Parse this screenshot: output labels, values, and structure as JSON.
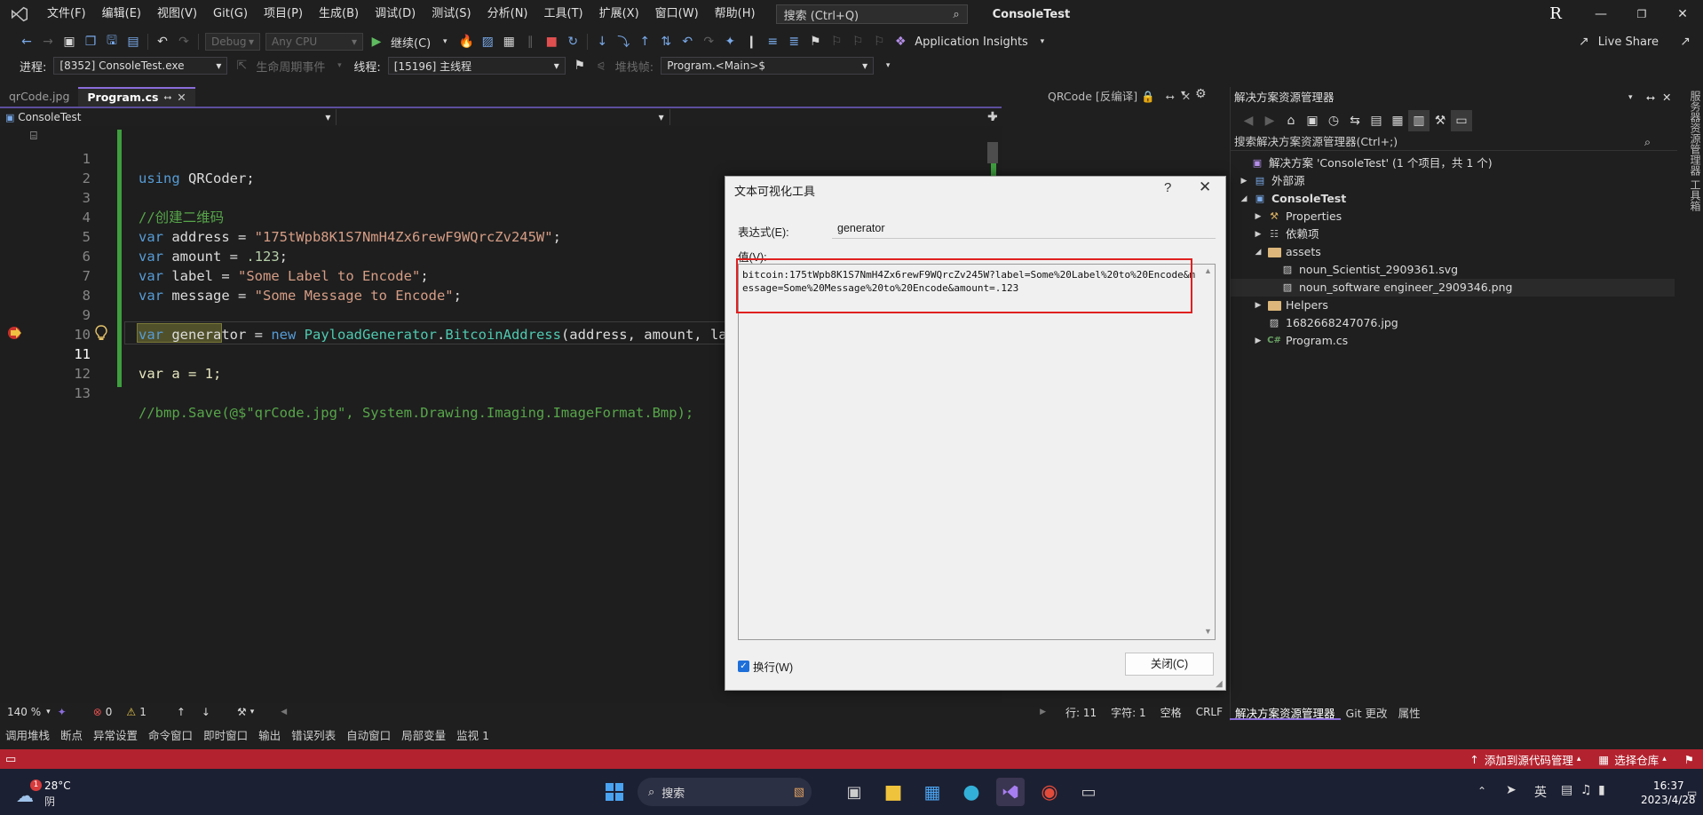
{
  "menubar": {
    "items": [
      "文件(F)",
      "编辑(E)",
      "视图(V)",
      "Git(G)",
      "项目(P)",
      "生成(B)",
      "调试(D)",
      "测试(S)",
      "分析(N)",
      "工具(T)",
      "扩展(X)",
      "窗口(W)",
      "帮助(H)"
    ],
    "search_placeholder": "搜索 (Ctrl+Q)",
    "app_title": "ConsoleTest",
    "user_initial": "R"
  },
  "toolbar1": {
    "config": "Debug",
    "platform": "Any CPU",
    "continue_label": "继续(C)",
    "app_insights": "Application Insights",
    "live_share": "Live Share"
  },
  "toolbar2": {
    "process_label": "进程:",
    "process_value": "[8352] ConsoleTest.exe",
    "lifecycle_label": "生命周期事件",
    "thread_label": "线程:",
    "thread_value": "[15196] 主线程",
    "stack_label": "堆栈帧:",
    "stack_value": "Program.<Main>$"
  },
  "editor_tabs": [
    {
      "label": "qrCode.jpg",
      "active": false
    },
    {
      "label": "Program.cs",
      "active": true
    }
  ],
  "qr_tab": "QRCode [反编译]",
  "navbar": {
    "project": "ConsoleTest"
  },
  "code_lines": [
    {
      "n": "1"
    },
    {
      "n": "2"
    },
    {
      "n": "3"
    },
    {
      "n": "4"
    },
    {
      "n": "5"
    },
    {
      "n": "6"
    },
    {
      "n": "7"
    },
    {
      "n": "8"
    },
    {
      "n": "9"
    },
    {
      "n": "10"
    },
    {
      "n": "11"
    },
    {
      "n": "12"
    },
    {
      "n": "13"
    }
  ],
  "code": {
    "l1_kw": "using",
    "l1_rest": " QRCoder;",
    "l3": "//创建二维码",
    "l4_kw": "var",
    "l4_id": " address = ",
    "l4_str": "\"175tWpb8K1S7NmH4Zx6rewF9WQrcZv245W\"",
    "l4_end": ";",
    "l5_kw": "var",
    "l5_id": " amount = ",
    "l5_num": ".123",
    "l5_end": ";",
    "l6_kw": "var",
    "l6_id": " label = ",
    "l6_str": "\"Some Label to Encode\"",
    "l6_end": ";",
    "l7_kw": "var",
    "l7_id": " message = ",
    "l7_str": "\"Some Message to Encode\"",
    "l7_end": ";",
    "l9_kw": "var",
    "l9_id": " generator = ",
    "l9_new": "new",
    "l9_type": " PayloadGenerator",
    "l9_dot": ".",
    "l9_type2": "BitcoinAddress",
    "l9_args": "(address, amount, labe",
    "l11": "var a = 1;",
    "l13": "//bmp.Save(@$\"qrCode.jpg\", System.Drawing.Imaging.ImageFormat.Bmp);"
  },
  "editor_status": {
    "zoom": "140 %",
    "errors": "0",
    "warnings": "1",
    "line": "行: 11",
    "col": "字符: 1",
    "spaces": "空格",
    "eol": "CRLF"
  },
  "bottom_tabs": [
    "调用堆栈",
    "断点",
    "异常设置",
    "命令窗口",
    "即时窗口",
    "输出",
    "错误列表",
    "自动窗口",
    "局部变量",
    "监视 1"
  ],
  "statusbar": {
    "add_source": "添加到源代码管理",
    "select_repo": "选择仓库"
  },
  "solution": {
    "title": "解决方案资源管理器",
    "search": "搜索解决方案资源管理器(Ctrl+;)",
    "root": "解决方案 'ConsoleTest' (1 个项目，共 1 个)",
    "external": "外部源",
    "project": "ConsoleTest",
    "properties": "Properties",
    "deps": "依赖项",
    "assets": "assets",
    "file_svg": "noun_Scientist_2909361.svg",
    "file_png": "noun_software engineer_2909346.png",
    "helpers": "Helpers",
    "file_jpg": "1682668247076.jpg",
    "program": "Program.cs",
    "tabs": [
      "解决方案资源管理器",
      "Git 更改",
      "属性"
    ],
    "right_strip": "服务器资源管理器 工具箱"
  },
  "dialog": {
    "title": "文本可视化工具",
    "help": "?",
    "expr_label": "表达式(E):",
    "expr_value": "generator",
    "value_label": "值(V):",
    "value_text": "bitcoin:175tWpb8K1S7NmH4Zx6rewF9WQrcZv245W?label=Some%20Label%20to%20Encode&message=Some%20Message%20to%20Encode&amount=.123",
    "wrap_label": "换行(W)",
    "close_label": "关闭(C)"
  },
  "taskbar": {
    "temp": "28°C",
    "weather": "阴",
    "search": "搜索",
    "ime": "英",
    "time": "16:37",
    "date": "2023/4/28",
    "badge": "1"
  },
  "colors": {
    "status_red": "#b3232f",
    "accent_purple": "#8a6cdb",
    "change_green": "#3e9e3e",
    "highlight_box": "#e02020"
  }
}
